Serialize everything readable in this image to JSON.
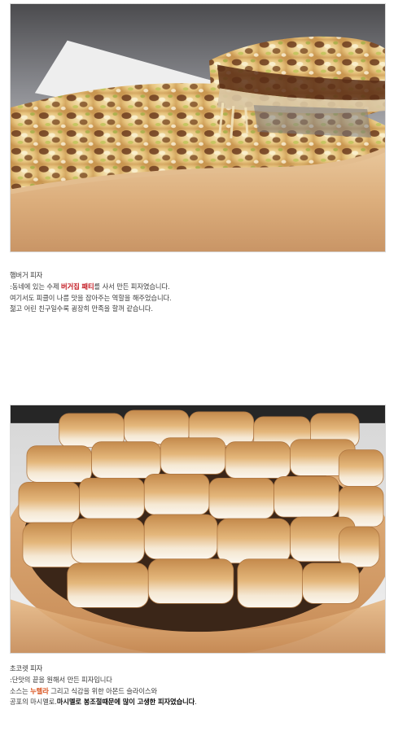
{
  "post": {
    "section1": {
      "title": "햄버거 피자",
      "line1_a": ":동네에 있는 수제 ",
      "line1_b": "버거집 패티",
      "line1_c": "를 사서 만든 피자였습니다.",
      "line2": "여기서도 피클이 나름 맛을 잡아주는 역할을 해주었습니다.",
      "line3": "젊고 어린 친구일수록 굉장히 만족을 할꺼 같습니다."
    },
    "section2": {
      "title": "초코렛 피자",
      "line1": ":단맛의 끝을 원해서 만든 피자입니다",
      "line2_a": "소스는 ",
      "line2_b": "누텔라",
      "line2_c": " 그리고 식감을 위한 아몬드 슬라이스와",
      "line3_a": "공포의 마시멜로.",
      "line3_b": "마시멜로 봉조절때문에 많이 고생한 피자였습니다",
      "line3_c": "."
    }
  },
  "colors": {
    "highlight_red": "#c2161e",
    "highlight_orange": "#d9531e"
  }
}
